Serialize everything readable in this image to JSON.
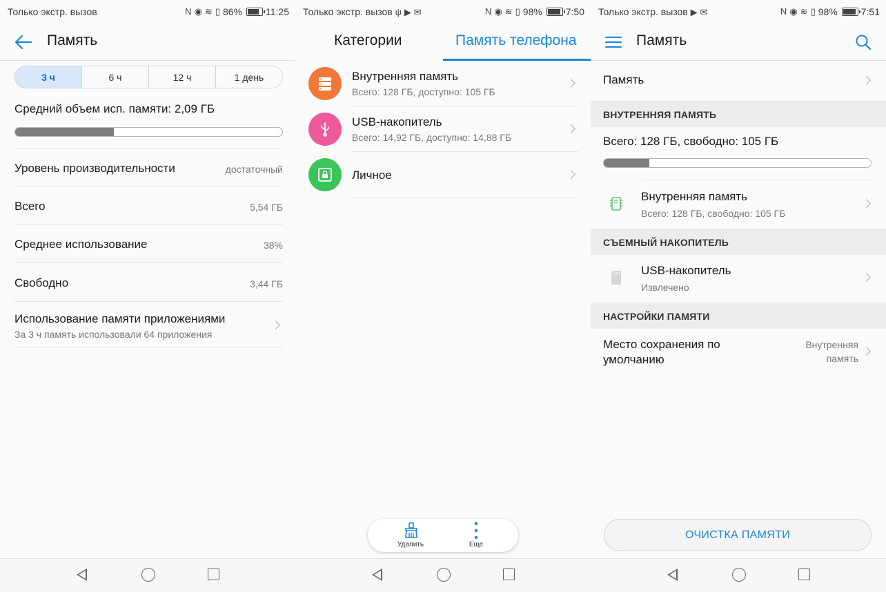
{
  "screens": [
    {
      "status": {
        "carrier": "Только экстр. вызов",
        "battery": "86%",
        "battery_level": 0.86,
        "time": "11:25"
      },
      "title": "Память",
      "segments": [
        "3 ч",
        "6 ч",
        "12 ч",
        "1 день"
      ],
      "active_segment": "3 ч",
      "avg_label": "Средний объем исп. памяти: 2,09 ГБ",
      "avg_fraction": 0.37,
      "rows": [
        {
          "label": "Уровень производительности",
          "value": "достаточный"
        },
        {
          "label": "Всего",
          "value": "5,54 ГБ"
        },
        {
          "label": "Среднее использование",
          "value": "38%"
        },
        {
          "label": "Свободно",
          "value": "3,44 ГБ"
        }
      ],
      "apps_row": {
        "label": "Использование памяти приложениями",
        "sub": "За 3 ч память использовали 64 приложения"
      }
    },
    {
      "status": {
        "carrier": "Только экстр. вызов",
        "battery": "98%",
        "battery_level": 0.98,
        "time": "7:50"
      },
      "tabs": [
        "Категории",
        "Память телефона"
      ],
      "active_tab": "Память телефона",
      "items": [
        {
          "title": "Внутренняя память",
          "sub": "Всего: 128 ГБ, доступно: 105 ГБ",
          "icon": "storage-icon",
          "color": "#f0793a"
        },
        {
          "title": "USB-накопитель",
          "sub": "Всего: 14,92 ГБ, доступно: 14,88 ГБ",
          "icon": "usb-icon",
          "color": "#ee5a9c"
        },
        {
          "title": "Личное",
          "sub": "",
          "icon": "safe-icon",
          "color": "#3cc45c"
        }
      ],
      "actions": [
        {
          "label": "Удалить",
          "icon": "cleanup-brush-icon"
        },
        {
          "label": "Еще",
          "icon": "more-vertical-icon"
        }
      ],
      "accent": "#1a86d8"
    },
    {
      "status": {
        "carrier": "Только экстр. вызов",
        "battery": "98%",
        "battery_level": 0.98,
        "time": "7:51"
      },
      "title": "Память",
      "memory_row": "Память",
      "internal_header": "ВНУТРЕННЯЯ ПАМЯТЬ",
      "internal_total": "Всего: 128 ГБ, свободно: 105 ГБ",
      "internal_used_fraction": 0.17,
      "internal_item": {
        "title": "Внутренняя память",
        "sub": "Всего: 128 ГБ, свободно: 105 ГБ"
      },
      "removable_header": "СЪЕМНЫЙ НАКОПИТЕЛЬ",
      "usb_item": {
        "title": "USB-накопитель",
        "sub": "Извлечено"
      },
      "settings_header": "НАСТРОЙКИ ПАМЯТИ",
      "default_location": {
        "label_line1": "Место сохранения по",
        "label_line2": "умолчанию",
        "value_line1": "Внутренняя",
        "value_line2": "память"
      },
      "clean_button": "ОЧИСТКА ПАМЯТИ"
    }
  ]
}
